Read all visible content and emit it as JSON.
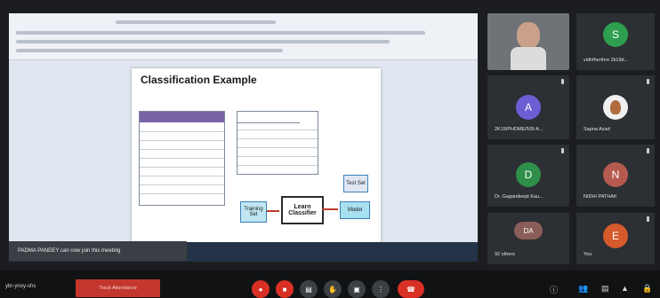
{
  "shared_screen": {
    "slide_title": "Classification Example",
    "diagram": {
      "training_label": "Training Set",
      "learn_label": "Learn Classifier",
      "model_label": "Model",
      "test_label": "Test Set"
    }
  },
  "notification": {
    "text": "PADMA PANDEY can now join this meeting"
  },
  "participants": [
    {
      "name": "",
      "initial": "",
      "color": "#6b6f73"
    },
    {
      "name": "vidhfherthre 2k19d...",
      "initial": "S",
      "color": "#2e9e4f"
    },
    {
      "name": "2K19/PHDME/509 A...",
      "initial": "A",
      "color": "#6c5fd6"
    },
    {
      "name": "Sapna Azad",
      "initial": "",
      "color": "#b06b3e"
    },
    {
      "name": "Dr. Gagandeept Kau...",
      "initial": "D",
      "color": "#2f8f4a"
    },
    {
      "name": "NIDHI PATHAK",
      "initial": "N",
      "color": "#b65a4f"
    },
    {
      "name": "92 others",
      "initial": "DA",
      "color": "#8a5e58"
    },
    {
      "name": "You",
      "initial": "E",
      "color": "#d65a2c"
    }
  ],
  "bottom_bar": {
    "meeting_code": "ybr-ynoy-shs",
    "track_attendance_label": "Track Attendance"
  },
  "colors": {
    "end_call": "#d93025",
    "accent_red": "#c4372e"
  }
}
